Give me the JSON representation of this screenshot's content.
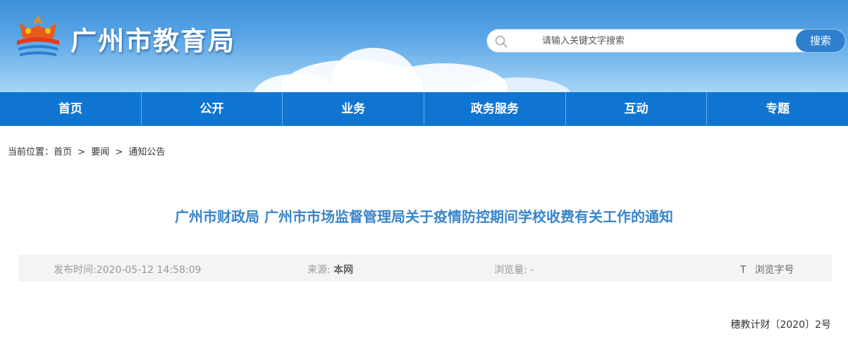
{
  "header": {
    "site_title": "广州市教育局",
    "search_placeholder": "请输入关键文字搜索",
    "search_button": "搜索"
  },
  "nav": {
    "items": [
      "首页",
      "公开",
      "业务",
      "政务服务",
      "互动",
      "专题"
    ]
  },
  "breadcrumb": {
    "label": "当前位置：",
    "items": [
      "首页",
      "要闻",
      "通知公告"
    ],
    "separator": ">"
  },
  "article": {
    "title": "广州市财政局 广州市市场监督管理局关于疫情防控期间学校收费有关工作的通知",
    "publish_label": "发布时间:",
    "publish_time": "2020-05-12 14:58:09",
    "source_label": "来源: ",
    "source_value": "本网",
    "views_label": "浏览量: ",
    "views_value": "-",
    "font_size_icon": "T",
    "font_size_label": "浏览字号",
    "doc_number": "穗教计财〔2020〕2号"
  },
  "colors": {
    "nav_bg": "#0f75d1",
    "title_blue": "#3a85cc",
    "search_btn": "#2e80cf"
  }
}
